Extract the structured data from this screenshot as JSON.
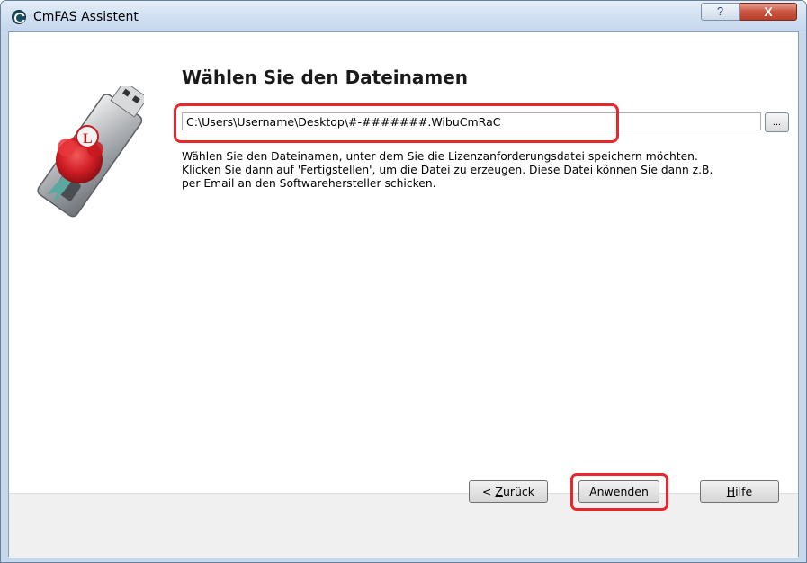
{
  "window": {
    "title": "CmFAS Assistent",
    "help_glyph": "?",
    "close_glyph": "X"
  },
  "page": {
    "heading": "Wählen Sie den Dateinamen",
    "path_value": "C:\\Users\\Username\\Desktop\\#-#######.WibuCmRaC",
    "browse_label": "...",
    "description": [
      "Wählen Sie den Dateinamen, unter dem Sie die Lizenzanforderungsdatei speichern möchten.",
      "Klicken Sie dann auf 'Fertigstellen', um die Datei zu erzeugen. Diese Datei können Sie dann z.B.",
      "per Email an den Softwarehersteller schicken."
    ]
  },
  "buttons": {
    "back_prefix": "< ",
    "back_mnemonic": "Z",
    "back_rest": "urück",
    "apply": "Anwenden",
    "help_mnemonic": "H",
    "help_rest": "ilfe"
  },
  "colors": {
    "highlight": "#e8262b",
    "title_bar": "#d2e1f2",
    "close_button": "#c8553f"
  },
  "icons": {
    "app": "cmfas-app-icon",
    "wizard": "usb-dongle-with-wax-seal"
  }
}
